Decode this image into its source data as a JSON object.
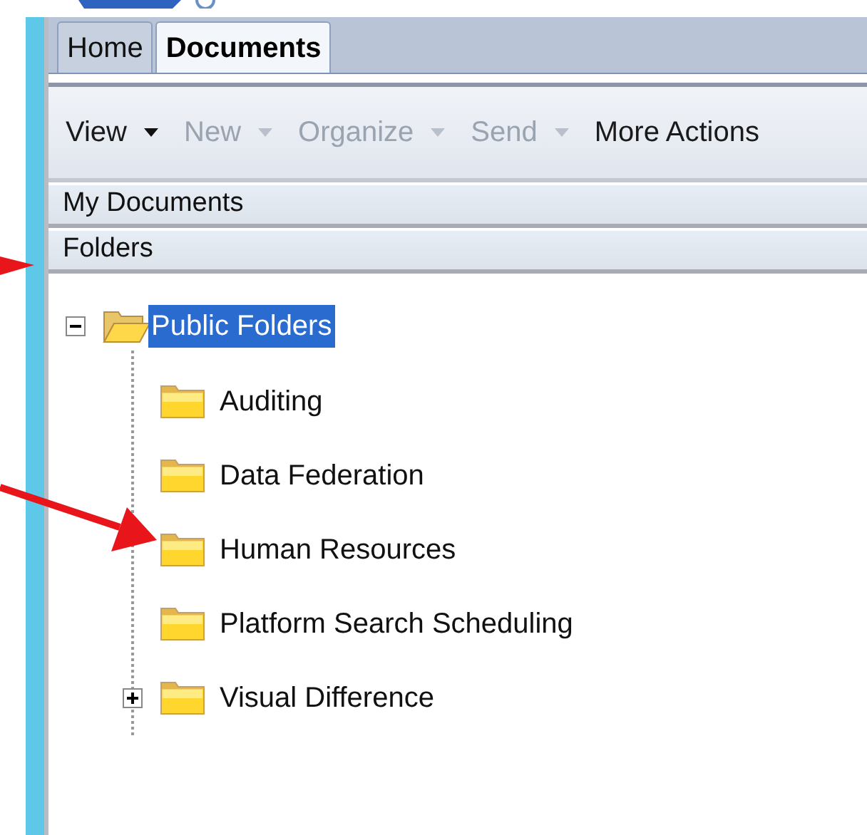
{
  "tabs": [
    {
      "label": "Home",
      "selected": false
    },
    {
      "label": "Documents",
      "selected": true
    }
  ],
  "toolbar": [
    {
      "label": "View",
      "disabled": false,
      "dropdown": true
    },
    {
      "label": "New",
      "disabled": true,
      "dropdown": true
    },
    {
      "label": "Organize",
      "disabled": true,
      "dropdown": true
    },
    {
      "label": "Send",
      "disabled": true,
      "dropdown": true
    },
    {
      "label": "More Actions",
      "disabled": false,
      "dropdown": false
    }
  ],
  "sections": [
    "My Documents",
    "Folders"
  ],
  "tree": [
    {
      "label": "Public Folders",
      "selected": true,
      "expanded": true,
      "open": true,
      "children": [
        {
          "label": "Auditing",
          "selected": false
        },
        {
          "label": "Data Federation",
          "selected": false
        },
        {
          "label": "Human Resources",
          "selected": false
        },
        {
          "label": "Platform Search Scheduling",
          "selected": false
        },
        {
          "label": "Visual Difference",
          "selected": false,
          "expanded": false
        }
      ]
    }
  ]
}
